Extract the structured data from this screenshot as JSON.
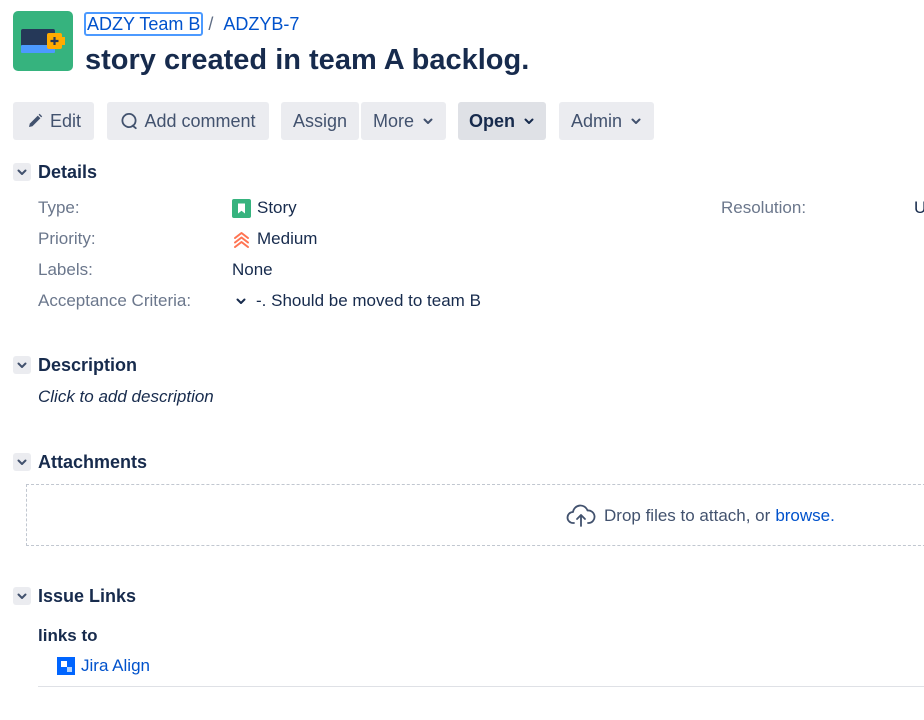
{
  "breadcrumb": {
    "project": "ADZY Team B",
    "separator": "/",
    "issue_key": "ADZYB-7"
  },
  "issue": {
    "summary": "story created in team A backlog."
  },
  "toolbar": {
    "edit": "Edit",
    "add_comment": "Add comment",
    "assign": "Assign",
    "more": "More",
    "status": "Open",
    "admin": "Admin"
  },
  "details": {
    "heading": "Details",
    "type_label": "Type:",
    "type_value": "Story",
    "priority_label": "Priority:",
    "priority_value": "Medium",
    "labels_label": "Labels:",
    "labels_value": "None",
    "acceptance_label": "Acceptance Criteria:",
    "acceptance_value": "-. Should be moved to team B",
    "resolution_label": "Resolution:",
    "resolution_value": "U"
  },
  "description": {
    "heading": "Description",
    "placeholder": "Click to add description"
  },
  "attachments": {
    "heading": "Attachments",
    "drop_text": "Drop files to attach, or",
    "browse": "browse."
  },
  "issue_links": {
    "heading": "Issue Links",
    "relation": "links to",
    "items": [
      {
        "label": "Jira Align",
        "icon": "jira-align-icon"
      }
    ]
  },
  "colors": {
    "brand_link": "#0052cc",
    "project_avatar": "#36b37e",
    "story_icon": "#36b37e",
    "priority_medium": "#ff7452",
    "button_bg": "#ebecf0"
  }
}
